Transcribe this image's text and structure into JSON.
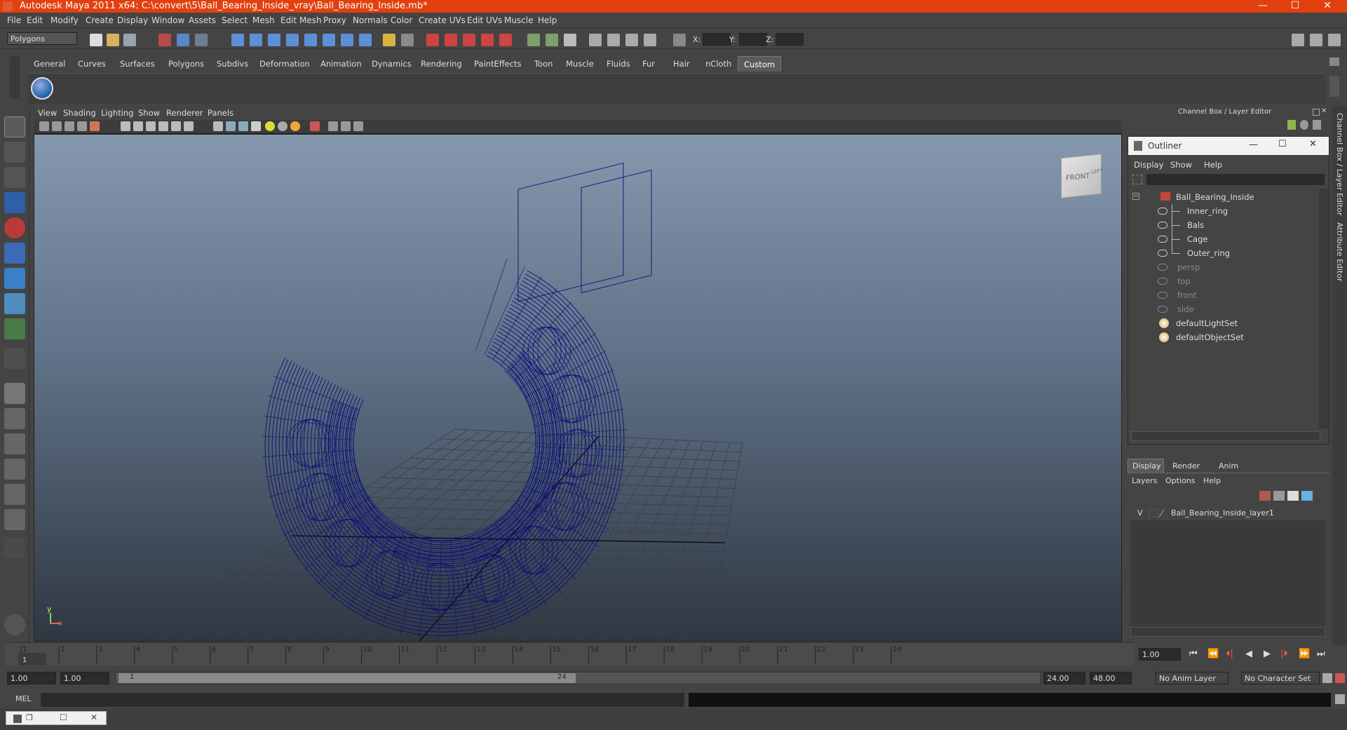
{
  "window": {
    "title": "Autodesk Maya 2011 x64: C:\\convert\\5\\Ball_Bearing_Inside_vray\\Ball_Bearing_Inside.mb*",
    "minimize": "—",
    "maximize": "☐",
    "close": "✕"
  },
  "menubar": [
    "File",
    "Edit",
    "Modify",
    "Create",
    "Display",
    "Window",
    "Assets",
    "Select",
    "Mesh",
    "Edit Mesh",
    "Proxy",
    "Normals",
    "Color",
    "Create UVs",
    "Edit UVs",
    "Muscle",
    "Help"
  ],
  "statusline": {
    "mode": "Polygons",
    "x_label": "X:",
    "y_label": "Y:",
    "z_label": "Z:"
  },
  "shelf": {
    "tabs": [
      "General",
      "Curves",
      "Surfaces",
      "Polygons",
      "Subdivs",
      "Deformation",
      "Animation",
      "Dynamics",
      "Rendering",
      "PaintEffects",
      "Toon",
      "Muscle",
      "Fluids",
      "Fur",
      "Hair",
      "nCloth",
      "Custom"
    ],
    "active_tab": "Custom"
  },
  "viewport": {
    "menu": [
      "View",
      "Shading",
      "Lighting",
      "Show",
      "Renderer",
      "Panels"
    ],
    "viewcube_front": "FRONT",
    "viewcube_left": "LEFT",
    "axis_y": "y",
    "axis_x": "x",
    "wire_color": "#0b0f7a"
  },
  "channelbox": {
    "title": "Channel Box / Layer Editor"
  },
  "outliner": {
    "title": "Outliner",
    "menu": [
      "Display",
      "Show",
      "Help"
    ],
    "items": [
      {
        "label": "Ball_Bearing_Inside",
        "indent": 0,
        "dim": false
      },
      {
        "label": "Inner_ring",
        "indent": 1,
        "dim": false
      },
      {
        "label": "Bals",
        "indent": 1,
        "dim": false
      },
      {
        "label": "Cage",
        "indent": 1,
        "dim": false
      },
      {
        "label": "Outer_ring",
        "indent": 1,
        "dim": false
      },
      {
        "label": "persp",
        "indent": 0,
        "dim": true
      },
      {
        "label": "top",
        "indent": 0,
        "dim": true
      },
      {
        "label": "front",
        "indent": 0,
        "dim": true
      },
      {
        "label": "side",
        "indent": 0,
        "dim": true
      },
      {
        "label": "defaultLightSet",
        "indent": 0,
        "dim": false
      },
      {
        "label": "defaultObjectSet",
        "indent": 0,
        "dim": false
      }
    ]
  },
  "layer_editor": {
    "tabs": [
      "Display",
      "Render",
      "Anim"
    ],
    "active_tab": "Display",
    "menu": [
      "Layers",
      "Options",
      "Help"
    ],
    "layer": {
      "visible": "V",
      "name": "Ball_Bearing_Inside_layer1"
    }
  },
  "side_tabs": [
    "Channel Box / Layer Editor",
    "Attribute Editor"
  ],
  "timeline": {
    "ticks": [
      "1",
      "2",
      "3",
      "4",
      "5",
      "6",
      "7",
      "8",
      "9",
      "10",
      "11",
      "12",
      "13",
      "14",
      "15",
      "16",
      "17",
      "18",
      "19",
      "20",
      "21",
      "22",
      "23",
      "24"
    ],
    "current_frame_marker": "1",
    "current_time": "1.00"
  },
  "playback": {
    "buttons": [
      "⏮",
      "⏪",
      "⏴|",
      "◀",
      "▶",
      "|⏵",
      "⏩",
      "⏭"
    ]
  },
  "range": {
    "start": "1.00",
    "anim_start": "1.00",
    "slider_start": "1",
    "slider_end": "24",
    "range_end": "24.00",
    "anim_end": "48.00",
    "anim_layer": "No Anim Layer",
    "character_set": "No Character Set"
  },
  "command": {
    "label": "MEL"
  }
}
